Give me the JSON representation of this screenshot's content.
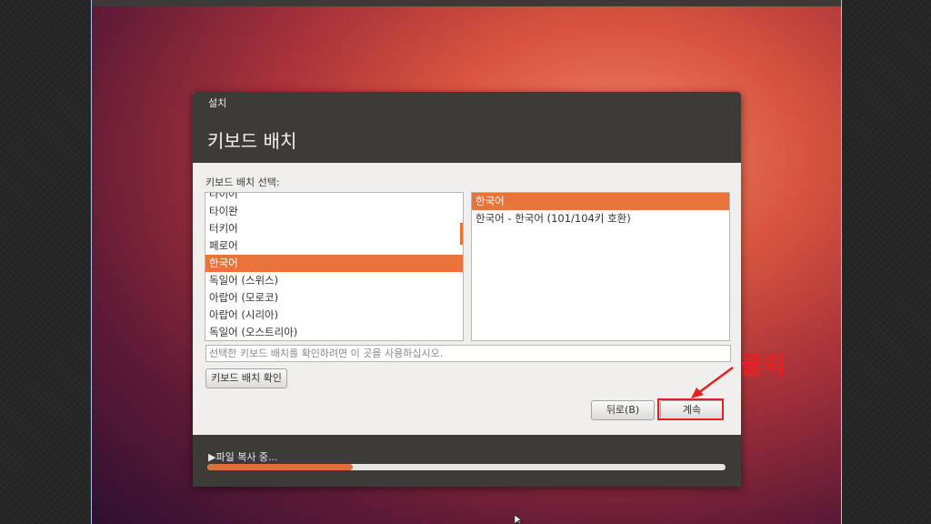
{
  "window_title": "설치",
  "page_title": "키보드 배치",
  "section_label": "키보드 배치 선택:",
  "layouts": [
    {
      "label": "타이어",
      "selected": false
    },
    {
      "label": "타이완",
      "selected": false
    },
    {
      "label": "터키어",
      "selected": false
    },
    {
      "label": "페로어",
      "selected": false
    },
    {
      "label": "한국어",
      "selected": true
    },
    {
      "label": "독일어 (스위스)",
      "selected": false
    },
    {
      "label": "아랍어 (모로코)",
      "selected": false
    },
    {
      "label": "아랍어 (시리아)",
      "selected": false
    },
    {
      "label": "독일어 (오스트리아)",
      "selected": false
    }
  ],
  "variants": [
    {
      "label": "한국어",
      "selected": true
    },
    {
      "label": "한국어 - 한국어 (101/104키 호환)",
      "selected": false
    }
  ],
  "test_input_placeholder": "선택한 키보드 배치를 확인하려면 이 곳을 사용하십시오.",
  "buttons": {
    "detect": "키보드 배치 확인",
    "back": "뒤로(B)",
    "continue": "계속"
  },
  "status": {
    "text": "▶파일 복사 중...",
    "progress_percent": 28
  },
  "annotation": {
    "text": "클릭"
  },
  "colors": {
    "accent": "#e8743c",
    "annotation": "#e52222",
    "header": "#3d3b37"
  }
}
